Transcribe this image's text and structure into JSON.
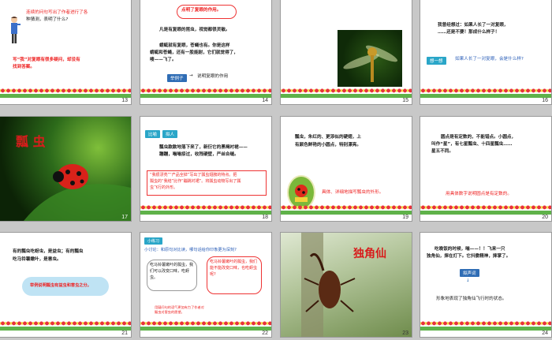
{
  "slides": [
    {
      "num": "13",
      "line1": "连续的问句写出了作者进行了各",
      "line2": "种猜测，表明了什么?",
      "answer1": "写“我”对复眼有很多疑问，却没有",
      "answer2": "找到答案。"
    },
    {
      "num": "14",
      "title": "点明了复眼的作用。",
      "line1": "凡是有复眼的昆虫，视觉都很灵敏。",
      "line2": "蜻蜓就有复眼，苍蝇也有。你是这样",
      "line3": "蜻蜓和苍蝇，还有一股能耐，它们就觉得了，",
      "line4": "嗖——飞了。",
      "btn": "举例子",
      "note": "说明复眼的作用"
    },
    {
      "num": "15"
    },
    {
      "num": "16",
      "line1": "我曾经想过：如果人长了一对复眼，",
      "line2": "……还是不要！那成什么样子！",
      "tag": "想一想",
      "question": "如果人长了一对复眼，会是什么样?"
    },
    {
      "num": "17",
      "title": "瓢 虫"
    },
    {
      "num": "18",
      "tag1": "比喻",
      "tag2": "拟人",
      "line1": "瓢虫款款地落下来了，新衍它的黑褐衬裙——",
      "line2": "蹦蹦，嗡嗡掠过，收残硬壁，严丝合缝。",
      "box1": "“我很漂亮”“产品全掉”写出了瓢虫翅膀的特点。把",
      "box2": "瓢虫的“我结”比作“蹦跳衬裙”。将瓢虫动物写出了瓢",
      "box3": "虫飞行的外形。"
    },
    {
      "num": "19",
      "line1": "瓢虫，朱红的、更添似的硬翅，上",
      "line2": "有颜色鲜艳的小圆点，特别漂亮。",
      "note": "具体、详细地描写瓢虫的外形。"
    },
    {
      "num": "20",
      "line1": "圆点是有定数的，不能错点。小圆点，",
      "line2": "叫作“星”，有七星瓢虫、十四星瓢虫……",
      "line3": "星五不同。",
      "note": "用具体数字说明圆点是有定数的。"
    },
    {
      "num": "21",
      "line1": "有的瓢虫吃蚜虫，是益虫；有的瓢虫",
      "line2": "吃马铃薯嫩叶，是害虫。",
      "cloud": "举例说明瓢虫有益虫和害虫之分。"
    },
    {
      "num": "22",
      "tag": "小练习",
      "line1": "小讨论：和原句对比读，哪句话给你印象更为深刻?",
      "left": "吃马铃薯嫩叶的瓢虫，我们可以改变口味，吃蚜虫。",
      "right": "吃马铃薯嫩叶的瓢虫，我们能不能改变口味，也吃蚜虫呢?",
      "caption": "用疑问句的语气更加有力了作者对瓢虫对害虫的愿望。"
    },
    {
      "num": "23",
      "title": "独角仙"
    },
    {
      "num": "24",
      "line1": "吃晚饭的时候，嗡——！！飞来一只",
      "line2": "独角仙，摔在灯下。它抖擞精神，摔掌了。",
      "tag": "拟声词",
      "note": "形象地表现了独角仙飞行时的状态。"
    }
  ],
  "colors": {
    "red": "#e22222",
    "blue": "#2f6db5",
    "grass": "#5fb24a"
  }
}
